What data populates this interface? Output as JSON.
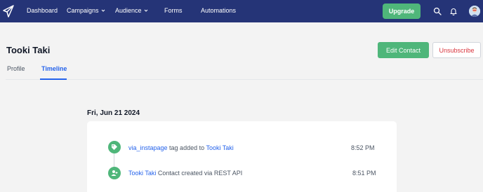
{
  "nav": {
    "logo_icon": "paper-plane-icon",
    "items": [
      {
        "label": "Dashboard",
        "has_dropdown": false
      },
      {
        "label": "Campaigns",
        "has_dropdown": true
      },
      {
        "label": "Audience",
        "has_dropdown": true
      },
      {
        "label": "Forms",
        "has_dropdown": false
      },
      {
        "label": "Automations",
        "has_dropdown": false
      }
    ],
    "upgrade_label": "Upgrade",
    "search_icon": "search-icon",
    "bell_icon": "bell-icon",
    "avatar_icon": "user-avatar"
  },
  "contact": {
    "name": "Tooki Taki",
    "edit_label": "Edit Contact",
    "unsubscribe_label": "Unsubscribe"
  },
  "tabs": [
    {
      "label": "Profile",
      "active": false
    },
    {
      "label": "Timeline",
      "active": true
    }
  ],
  "timeline": {
    "date": "Fri, Jun 21 2024",
    "events": [
      {
        "icon": "tag-icon",
        "link1": "via_instapage",
        "mid": " tag added to ",
        "link2": "Tooki Taki",
        "time": "8:52 PM"
      },
      {
        "icon": "user-plus-icon",
        "link1": "Tooki Taki",
        "mid": " Contact created via REST API",
        "link2": "",
        "time": "8:51 PM"
      }
    ]
  },
  "colors": {
    "nav_bg": "#253477",
    "accent_green": "#4fb67a",
    "link_blue": "#2563eb",
    "danger_red": "#d9363e",
    "page_bg": "#f3f3f3"
  }
}
